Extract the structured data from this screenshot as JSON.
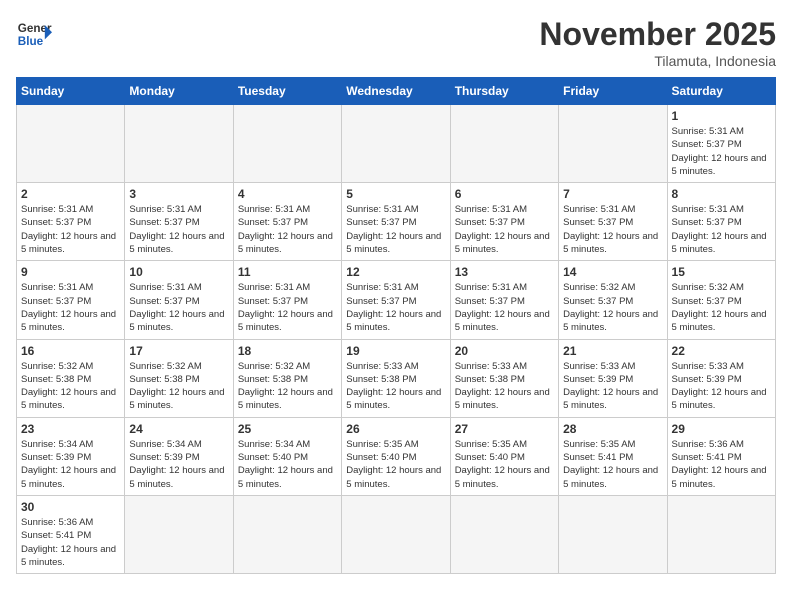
{
  "logo": {
    "general": "General",
    "blue": "Blue"
  },
  "header": {
    "month": "November 2025",
    "location": "Tilamuta, Indonesia"
  },
  "weekdays": [
    "Sunday",
    "Monday",
    "Tuesday",
    "Wednesday",
    "Thursday",
    "Friday",
    "Saturday"
  ],
  "weeks": [
    [
      {
        "day": "",
        "info": ""
      },
      {
        "day": "",
        "info": ""
      },
      {
        "day": "",
        "info": ""
      },
      {
        "day": "",
        "info": ""
      },
      {
        "day": "",
        "info": ""
      },
      {
        "day": "",
        "info": ""
      },
      {
        "day": "1",
        "info": "Sunrise: 5:31 AM\nSunset: 5:37 PM\nDaylight: 12 hours and 5 minutes."
      }
    ],
    [
      {
        "day": "2",
        "info": "Sunrise: 5:31 AM\nSunset: 5:37 PM\nDaylight: 12 hours and 5 minutes."
      },
      {
        "day": "3",
        "info": "Sunrise: 5:31 AM\nSunset: 5:37 PM\nDaylight: 12 hours and 5 minutes."
      },
      {
        "day": "4",
        "info": "Sunrise: 5:31 AM\nSunset: 5:37 PM\nDaylight: 12 hours and 5 minutes."
      },
      {
        "day": "5",
        "info": "Sunrise: 5:31 AM\nSunset: 5:37 PM\nDaylight: 12 hours and 5 minutes."
      },
      {
        "day": "6",
        "info": "Sunrise: 5:31 AM\nSunset: 5:37 PM\nDaylight: 12 hours and 5 minutes."
      },
      {
        "day": "7",
        "info": "Sunrise: 5:31 AM\nSunset: 5:37 PM\nDaylight: 12 hours and 5 minutes."
      },
      {
        "day": "8",
        "info": "Sunrise: 5:31 AM\nSunset: 5:37 PM\nDaylight: 12 hours and 5 minutes."
      }
    ],
    [
      {
        "day": "9",
        "info": "Sunrise: 5:31 AM\nSunset: 5:37 PM\nDaylight: 12 hours and 5 minutes."
      },
      {
        "day": "10",
        "info": "Sunrise: 5:31 AM\nSunset: 5:37 PM\nDaylight: 12 hours and 5 minutes."
      },
      {
        "day": "11",
        "info": "Sunrise: 5:31 AM\nSunset: 5:37 PM\nDaylight: 12 hours and 5 minutes."
      },
      {
        "day": "12",
        "info": "Sunrise: 5:31 AM\nSunset: 5:37 PM\nDaylight: 12 hours and 5 minutes."
      },
      {
        "day": "13",
        "info": "Sunrise: 5:31 AM\nSunset: 5:37 PM\nDaylight: 12 hours and 5 minutes."
      },
      {
        "day": "14",
        "info": "Sunrise: 5:32 AM\nSunset: 5:37 PM\nDaylight: 12 hours and 5 minutes."
      },
      {
        "day": "15",
        "info": "Sunrise: 5:32 AM\nSunset: 5:37 PM\nDaylight: 12 hours and 5 minutes."
      }
    ],
    [
      {
        "day": "16",
        "info": "Sunrise: 5:32 AM\nSunset: 5:38 PM\nDaylight: 12 hours and 5 minutes."
      },
      {
        "day": "17",
        "info": "Sunrise: 5:32 AM\nSunset: 5:38 PM\nDaylight: 12 hours and 5 minutes."
      },
      {
        "day": "18",
        "info": "Sunrise: 5:32 AM\nSunset: 5:38 PM\nDaylight: 12 hours and 5 minutes."
      },
      {
        "day": "19",
        "info": "Sunrise: 5:33 AM\nSunset: 5:38 PM\nDaylight: 12 hours and 5 minutes."
      },
      {
        "day": "20",
        "info": "Sunrise: 5:33 AM\nSunset: 5:38 PM\nDaylight: 12 hours and 5 minutes."
      },
      {
        "day": "21",
        "info": "Sunrise: 5:33 AM\nSunset: 5:39 PM\nDaylight: 12 hours and 5 minutes."
      },
      {
        "day": "22",
        "info": "Sunrise: 5:33 AM\nSunset: 5:39 PM\nDaylight: 12 hours and 5 minutes."
      }
    ],
    [
      {
        "day": "23",
        "info": "Sunrise: 5:34 AM\nSunset: 5:39 PM\nDaylight: 12 hours and 5 minutes."
      },
      {
        "day": "24",
        "info": "Sunrise: 5:34 AM\nSunset: 5:39 PM\nDaylight: 12 hours and 5 minutes."
      },
      {
        "day": "25",
        "info": "Sunrise: 5:34 AM\nSunset: 5:40 PM\nDaylight: 12 hours and 5 minutes."
      },
      {
        "day": "26",
        "info": "Sunrise: 5:35 AM\nSunset: 5:40 PM\nDaylight: 12 hours and 5 minutes."
      },
      {
        "day": "27",
        "info": "Sunrise: 5:35 AM\nSunset: 5:40 PM\nDaylight: 12 hours and 5 minutes."
      },
      {
        "day": "28",
        "info": "Sunrise: 5:35 AM\nSunset: 5:41 PM\nDaylight: 12 hours and 5 minutes."
      },
      {
        "day": "29",
        "info": "Sunrise: 5:36 AM\nSunset: 5:41 PM\nDaylight: 12 hours and 5 minutes."
      }
    ],
    [
      {
        "day": "30",
        "info": "Sunrise: 5:36 AM\nSunset: 5:41 PM\nDaylight: 12 hours and 5 minutes."
      },
      {
        "day": "",
        "info": ""
      },
      {
        "day": "",
        "info": ""
      },
      {
        "day": "",
        "info": ""
      },
      {
        "day": "",
        "info": ""
      },
      {
        "day": "",
        "info": ""
      },
      {
        "day": "",
        "info": ""
      }
    ]
  ]
}
